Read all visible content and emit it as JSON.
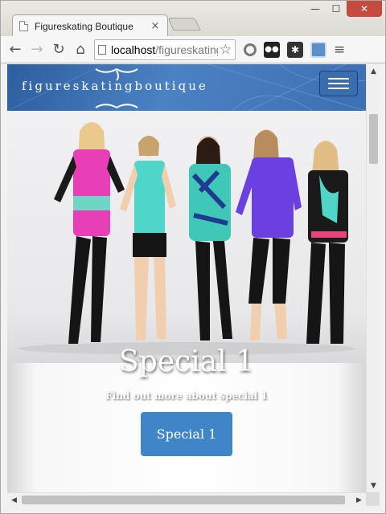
{
  "window": {
    "minimize_glyph": "—",
    "maximize_glyph": "☐",
    "close_glyph": "✕"
  },
  "tab": {
    "title": "Figureskating Boutique",
    "close_glyph": "×"
  },
  "toolbar": {
    "back_glyph": "←",
    "forward_glyph": "→",
    "reload_glyph": "↻",
    "home_glyph": "⌂",
    "url_host": "localhost",
    "url_path": "/figureskatingboutique",
    "bookmark_glyph": "☆",
    "menu_glyph": "≡",
    "extensions": [
      "circle-extension-icon",
      "incognito-mask-icon",
      "puzzle-extension-icon",
      "window-extension-icon"
    ]
  },
  "site": {
    "logo_text": "figureskatingboutique",
    "header_color": "#3c6fb3",
    "hero": {
      "heading": "Special 1",
      "subheading": "Find out more about special 1",
      "button_label": "Special 1",
      "button_color": "#3f86c9"
    }
  },
  "scrollbars": {
    "up_glyph": "▲",
    "down_glyph": "▼",
    "left_glyph": "◀",
    "right_glyph": "▶"
  }
}
